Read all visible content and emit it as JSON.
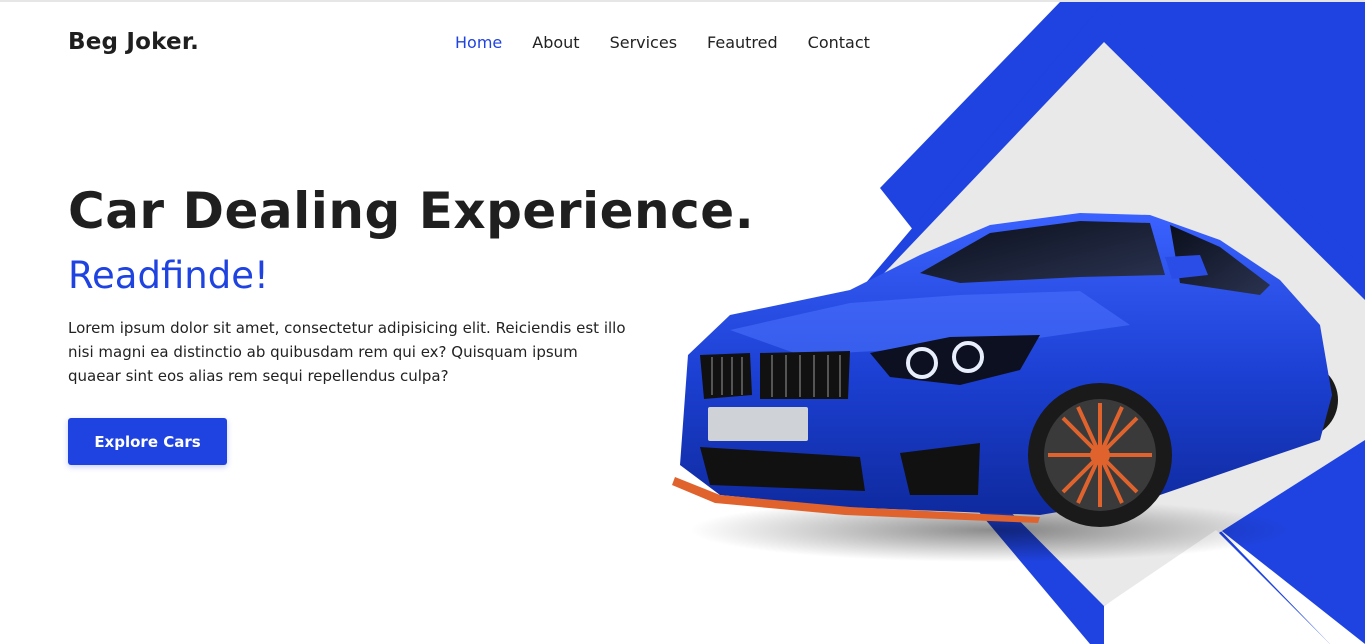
{
  "brand": {
    "name": "Beg Joker."
  },
  "nav": {
    "items": [
      {
        "label": "Home",
        "active": true
      },
      {
        "label": "About",
        "active": false
      },
      {
        "label": "Services",
        "active": false
      },
      {
        "label": "Feautred",
        "active": false
      },
      {
        "label": "Contact",
        "active": false
      }
    ]
  },
  "hero": {
    "title": "Car Dealing Experience.",
    "subtitle": "Readfinde!",
    "description": "Lorem ipsum dolor sit amet, consectetur adipisicing elit. Reiciendis est illo nisi magni ea distinctio ab quibusdam rem qui ex? Quisquam ipsum quaear sint eos alias rem sequi repellendus culpa?",
    "cta_label": "Explore Cars"
  },
  "colors": {
    "accent": "#1f43e0",
    "diamond_fill": "#e9e9ea",
    "car_body": "#1b3fd1",
    "wheel_accent": "#e0632e"
  },
  "images": {
    "hero_car": "blue-sports-car-image"
  }
}
